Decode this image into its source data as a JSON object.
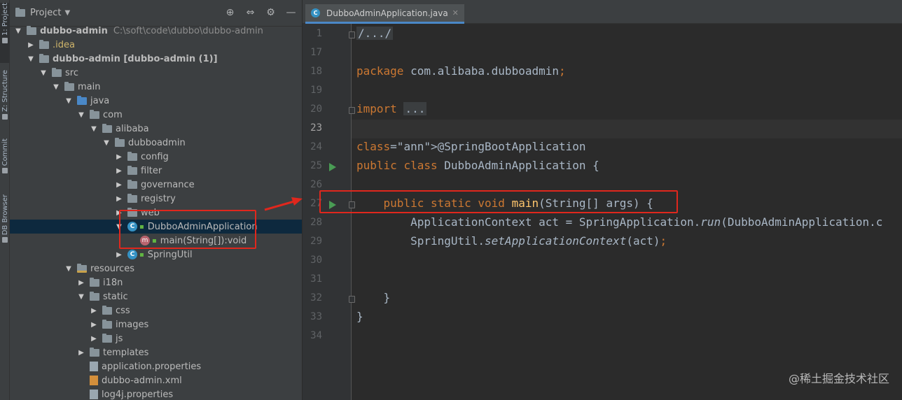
{
  "toolstrip": {
    "tabs": [
      "1: Project",
      "Z: Structure",
      "Commit",
      "DB Browser"
    ]
  },
  "project_panel": {
    "title": "Project",
    "tree": [
      {
        "label": "dubbo-admin",
        "path": "C:\\soft\\code\\dubbo\\dubbo-admin",
        "depth": 0,
        "expanded": true,
        "kind": "module"
      },
      {
        "label": ".idea",
        "depth": 1,
        "expanded": false,
        "kind": "idea"
      },
      {
        "label": "dubbo-admin [dubbo-admin (1)]",
        "depth": 1,
        "expanded": true,
        "kind": "module"
      },
      {
        "label": "src",
        "depth": 2,
        "expanded": true,
        "kind": "folder"
      },
      {
        "label": "main",
        "depth": 3,
        "expanded": true,
        "kind": "folder"
      },
      {
        "label": "java",
        "depth": 4,
        "expanded": true,
        "kind": "src"
      },
      {
        "label": "com",
        "depth": 5,
        "expanded": true,
        "kind": "folder"
      },
      {
        "label": "alibaba",
        "depth": 6,
        "expanded": true,
        "kind": "folder"
      },
      {
        "label": "dubboadmin",
        "depth": 7,
        "expanded": true,
        "kind": "folder"
      },
      {
        "label": "config",
        "depth": 8,
        "expanded": false,
        "kind": "folder"
      },
      {
        "label": "filter",
        "depth": 8,
        "expanded": false,
        "kind": "folder"
      },
      {
        "label": "governance",
        "depth": 8,
        "expanded": false,
        "kind": "folder"
      },
      {
        "label": "registry",
        "depth": 8,
        "expanded": false,
        "kind": "folder"
      },
      {
        "label": "web",
        "depth": 8,
        "expanded": false,
        "kind": "folder"
      },
      {
        "label": "DubboAdminApplication",
        "depth": 8,
        "expanded": true,
        "kind": "class",
        "selected": true
      },
      {
        "label": "main(String[]):void",
        "depth": 9,
        "kind": "method"
      },
      {
        "label": "SpringUtil",
        "depth": 8,
        "expanded": false,
        "kind": "class"
      },
      {
        "label": "resources",
        "depth": 4,
        "expanded": true,
        "kind": "res"
      },
      {
        "label": "i18n",
        "depth": 5,
        "expanded": false,
        "kind": "folder"
      },
      {
        "label": "static",
        "depth": 5,
        "expanded": true,
        "kind": "folder"
      },
      {
        "label": "css",
        "depth": 6,
        "expanded": false,
        "kind": "folder"
      },
      {
        "label": "images",
        "depth": 6,
        "expanded": false,
        "kind": "folder"
      },
      {
        "label": "js",
        "depth": 6,
        "expanded": false,
        "kind": "folder"
      },
      {
        "label": "templates",
        "depth": 5,
        "expanded": false,
        "kind": "folder"
      },
      {
        "label": "application.properties",
        "depth": 5,
        "kind": "props"
      },
      {
        "label": "dubbo-admin.xml",
        "depth": 5,
        "kind": "xml"
      },
      {
        "label": "log4j.properties",
        "depth": 5,
        "kind": "props"
      }
    ]
  },
  "editor": {
    "tab_label": "DubboAdminApplication.java",
    "current_line": "23",
    "lines": [
      {
        "n": "1",
        "text": "/.../"
      },
      {
        "n": "17",
        "text": ""
      },
      {
        "n": "18",
        "text": "package com.alibaba.dubboadmin;"
      },
      {
        "n": "19",
        "text": ""
      },
      {
        "n": "20",
        "text": "import ..."
      },
      {
        "n": "23",
        "text": ""
      },
      {
        "n": "24",
        "text": "@SpringBootApplication"
      },
      {
        "n": "25",
        "text": "public class DubboAdminApplication {"
      },
      {
        "n": "26",
        "text": ""
      },
      {
        "n": "27",
        "text": "    public static void main(String[] args) {"
      },
      {
        "n": "28",
        "text": "        ApplicationContext act = SpringApplication.run(DubboAdminApplication.c"
      },
      {
        "n": "29",
        "text": "        SpringUtil.setApplicationContext(act);"
      },
      {
        "n": "30",
        "text": ""
      },
      {
        "n": "31",
        "text": ""
      },
      {
        "n": "32",
        "text": "    }"
      },
      {
        "n": "33",
        "text": "}"
      },
      {
        "n": "34",
        "text": ""
      }
    ]
  },
  "watermark": "@稀土掘金技术社区",
  "colors": {
    "highlight_red": "#e0271d",
    "keyword": "#cc7832",
    "annotation": "#bbb529",
    "method": "#ffc66d",
    "run_green": "#499c54",
    "selection": "#0d293e"
  }
}
